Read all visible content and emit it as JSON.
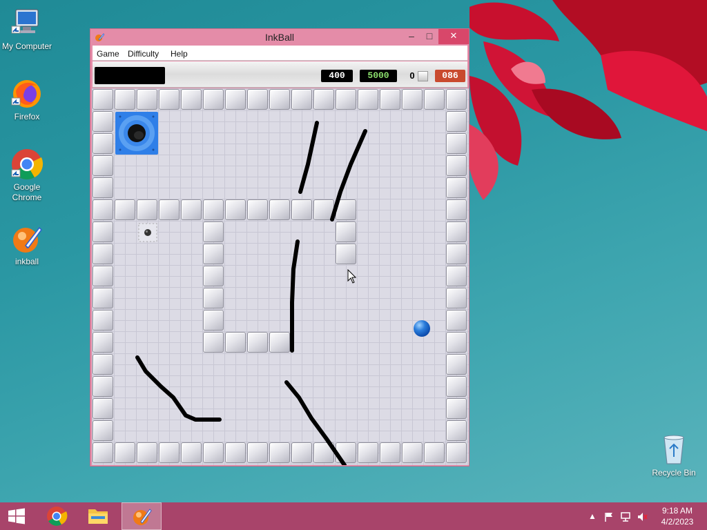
{
  "desktop": {
    "icons": [
      {
        "label": "My Computer",
        "icon": "computer-icon"
      },
      {
        "label": "Firefox",
        "icon": "firefox-icon"
      },
      {
        "label": "Google Chrome",
        "icon": "chrome-icon"
      },
      {
        "label": "inkball",
        "icon": "inkball-icon"
      }
    ],
    "recycle_bin": {
      "label": "Recycle Bin",
      "icon": "recycle-bin-icon"
    }
  },
  "window": {
    "title": "InkBall",
    "controls": {
      "minimize": "–",
      "maximize": "□",
      "close": "✕"
    },
    "menu": [
      "Game",
      "Difficulty",
      "Help"
    ],
    "scorebar": {
      "score": "400",
      "target": "5000",
      "balls_count": "0",
      "timer": "086"
    },
    "colors": {
      "blue_hole": "#2f7fe8",
      "ball": "#2b7ddb",
      "ink": "#000000"
    }
  },
  "taskbar": {
    "items": [
      "start-icon",
      "chrome-icon",
      "file-explorer-icon",
      "inkball-icon"
    ],
    "clock": {
      "time": "9:18 AM",
      "date": "4/2/2023"
    },
    "tray_icons": [
      "chevron-up-icon",
      "flag-icon",
      "network-icon",
      "speaker-muted-icon"
    ]
  }
}
